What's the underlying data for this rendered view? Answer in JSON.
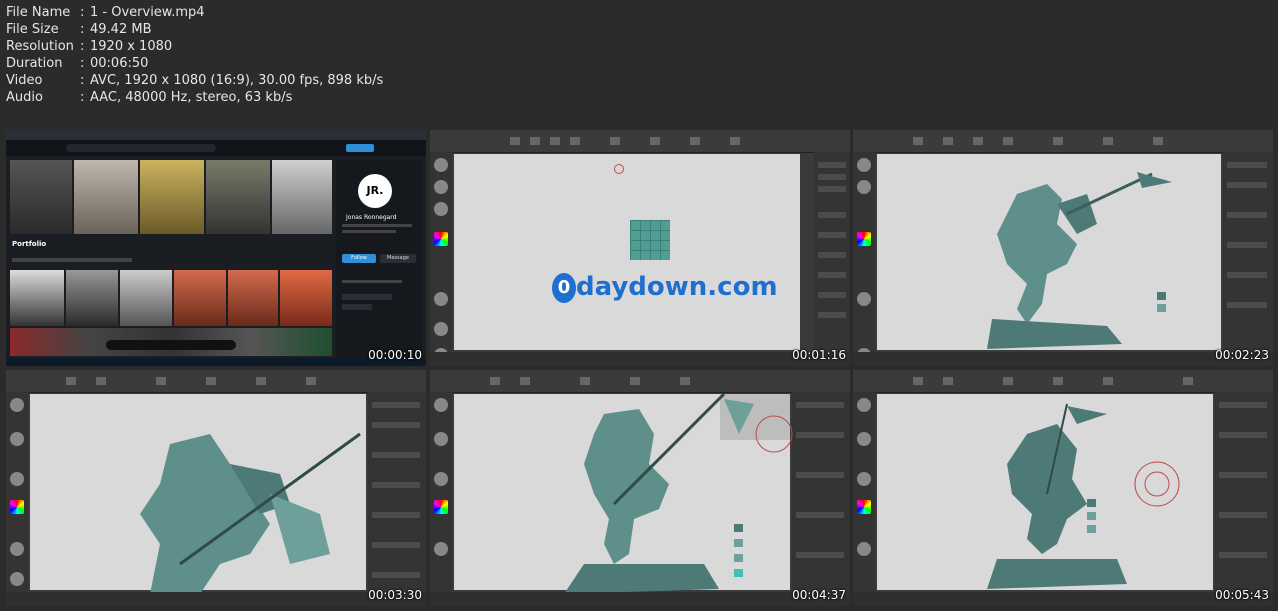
{
  "file_info": [
    {
      "key": "File Name",
      "value": "1 - Overview.mp4"
    },
    {
      "key": "File Size",
      "value": "49.42 MB"
    },
    {
      "key": "Resolution",
      "value": "1920 x 1080"
    },
    {
      "key": "Duration",
      "value": "00:06:50"
    },
    {
      "key": "Video",
      "value": "AVC, 1920 x 1080 (16:9), 30.00 fps, 898 kb/s"
    },
    {
      "key": "Audio",
      "value": "AAC, 48000 Hz, stereo, 63 kb/s"
    }
  ],
  "separator": ":",
  "thumbnails": [
    {
      "timestamp": "00:00:10",
      "kind": "website"
    },
    {
      "timestamp": "00:01:16",
      "kind": "zbrush-grid"
    },
    {
      "timestamp": "00:02:23",
      "kind": "zbrush-statue"
    },
    {
      "timestamp": "00:03:30",
      "kind": "zbrush-closeup"
    },
    {
      "timestamp": "00:04:37",
      "kind": "zbrush-statue"
    },
    {
      "timestamp": "00:05:43",
      "kind": "zbrush-statue"
    }
  ],
  "website": {
    "logo": "JR.",
    "name": "Jonas Ronnegard",
    "portfolio_label": "Portfolio",
    "follow_label": "Follow",
    "message_label": "Message"
  },
  "watermark": "daydown.com",
  "colors": {
    "background": "#2b2b2b",
    "model": "#5f8f8b",
    "canvas": "#d9d9d9",
    "accent_blue": "#2f8fd8"
  }
}
